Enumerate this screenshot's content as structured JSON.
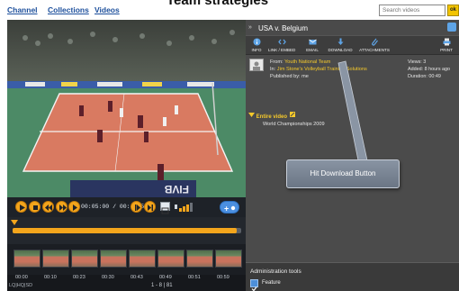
{
  "nav": {
    "channel": "Channel",
    "collections": "Collections",
    "videos": "Videos"
  },
  "page": {
    "title": "Team strategies"
  },
  "search": {
    "placeholder": "Search videos",
    "button_label": "ok"
  },
  "player": {
    "timecode": "00:05:00 / 00:49:5.5",
    "progress_fraction": 0.98,
    "quality_label": "LQ|HQ|SD",
    "pager": "1 - 8 | 81",
    "thumb_times": [
      "00:00",
      "00:10",
      "00:23",
      "00:30",
      "00:43",
      "00:49",
      "00:51",
      "00:59"
    ]
  },
  "panel": {
    "title": "USA v. Belgium",
    "tools": [
      {
        "label": "INFO",
        "icon": "info-icon"
      },
      {
        "label": "LINK / EMBED",
        "icon": "embed-icon"
      },
      {
        "label": "EMAIL",
        "icon": "email-icon"
      },
      {
        "label": "DOWNLOAD",
        "icon": "download-icon"
      },
      {
        "label": "ATTACHMENTS",
        "icon": "attachment-icon"
      },
      {
        "label": "PRINT",
        "icon": "print-icon"
      }
    ],
    "from_label": "From:",
    "from_value": "Youth National Team",
    "in_label": "In:",
    "in_value": "Jim Stone's Volleyball Training Solutions",
    "published": "Published by: me",
    "views": "Views: 3",
    "added": "Added: 8 hours ago",
    "duration": "Duration: 00:49",
    "section_title": "Entire video",
    "section_item": "World Championships 2009"
  },
  "callout": {
    "text": "Hit Download Button"
  },
  "admin": {
    "title": "Administration tools",
    "feature_label": "Feature"
  },
  "colors": {
    "accent": "#f3a51c",
    "link": "#1b4e9b",
    "highlight": "#f5c92b"
  }
}
